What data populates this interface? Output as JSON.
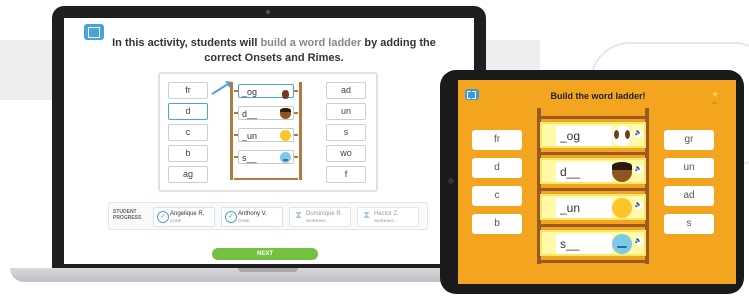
{
  "colors": {
    "accent": "#4aa3df",
    "next": "#74c142",
    "tablet_bg": "#f4a51f",
    "ladder": "#b5793e"
  },
  "laptop": {
    "book_icon": "book-icon",
    "title_start": "In this activity, students will ",
    "title_highlight": "build a word ladder",
    "title_end": " by adding the correct Onsets and Rimes.",
    "onsets": [
      "fr",
      "d",
      "c",
      "b",
      "ag"
    ],
    "selected_onset": "d",
    "rimes": [
      "ad",
      "un",
      "s",
      "wo",
      "f"
    ],
    "ladder_slots": [
      {
        "text": "_og",
        "icon": "dog-emoji-icon"
      },
      {
        "text": "d__",
        "icon": "boy-emoji-icon"
      },
      {
        "text": "_un",
        "icon": "sun-emoji-icon"
      },
      {
        "text": "s__",
        "icon": "sad-face-emoji-icon"
      }
    ],
    "progress_label": "STUDENT PROGRESS",
    "students": [
      {
        "name": "Angelique R.",
        "status": "DONE",
        "state": "done"
      },
      {
        "name": "Anthony V.",
        "status": "DONE",
        "state": "done"
      },
      {
        "name": "Dominique R.",
        "status": "WORKING...",
        "state": "working"
      },
      {
        "name": "Hector Z.",
        "status": "WORKING...",
        "state": "working"
      }
    ],
    "next_label": "NEXT"
  },
  "tablet": {
    "title": "Build the word ladder!",
    "star_icon": "star-icon",
    "star_count": "12",
    "onsets": [
      "fr",
      "d",
      "c",
      "b"
    ],
    "rimes": [
      "gr",
      "un",
      "ad",
      "s"
    ],
    "ladder_slots": [
      {
        "text": "_og",
        "icon": "dog-emoji-icon"
      },
      {
        "text": "d__",
        "icon": "boy-emoji-icon"
      },
      {
        "text": "_un",
        "icon": "sun-emoji-icon"
      },
      {
        "text": "s__",
        "icon": "sad-face-emoji-icon"
      }
    ]
  }
}
